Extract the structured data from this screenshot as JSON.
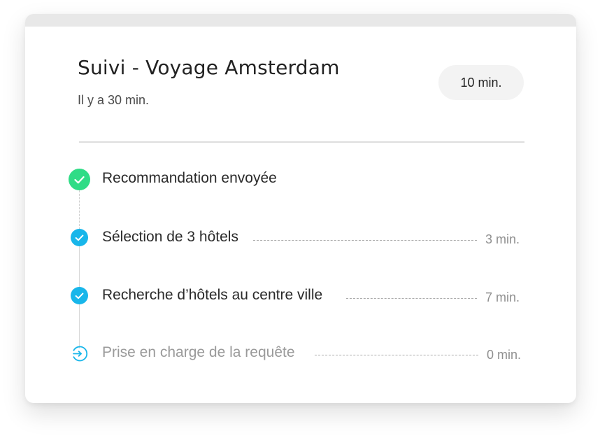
{
  "tracking": {
    "title": "Suivi - Voyage Amsterdam",
    "timestamp": "Il y a 30 min.",
    "total_duration": "10 min."
  },
  "steps": [
    {
      "label": "Recommandation envoyée",
      "time": "",
      "status": "done",
      "icon": "check-icon"
    },
    {
      "label": "Sélection de 3 hôtels",
      "time": "3 min.",
      "status": "done",
      "icon": "check-icon"
    },
    {
      "label": "Recherche d’hôtels au centre ville",
      "time": "7 min.",
      "status": "done",
      "icon": "check-icon"
    },
    {
      "label": "Prise en charge de la requête",
      "time": "0 min.",
      "status": "pending",
      "icon": "sign-in-icon"
    }
  ],
  "colors": {
    "done_primary": "#2fdc86",
    "done_secondary": "#18b6ea",
    "pending": "#18b6ea",
    "divider": "#dedede"
  }
}
